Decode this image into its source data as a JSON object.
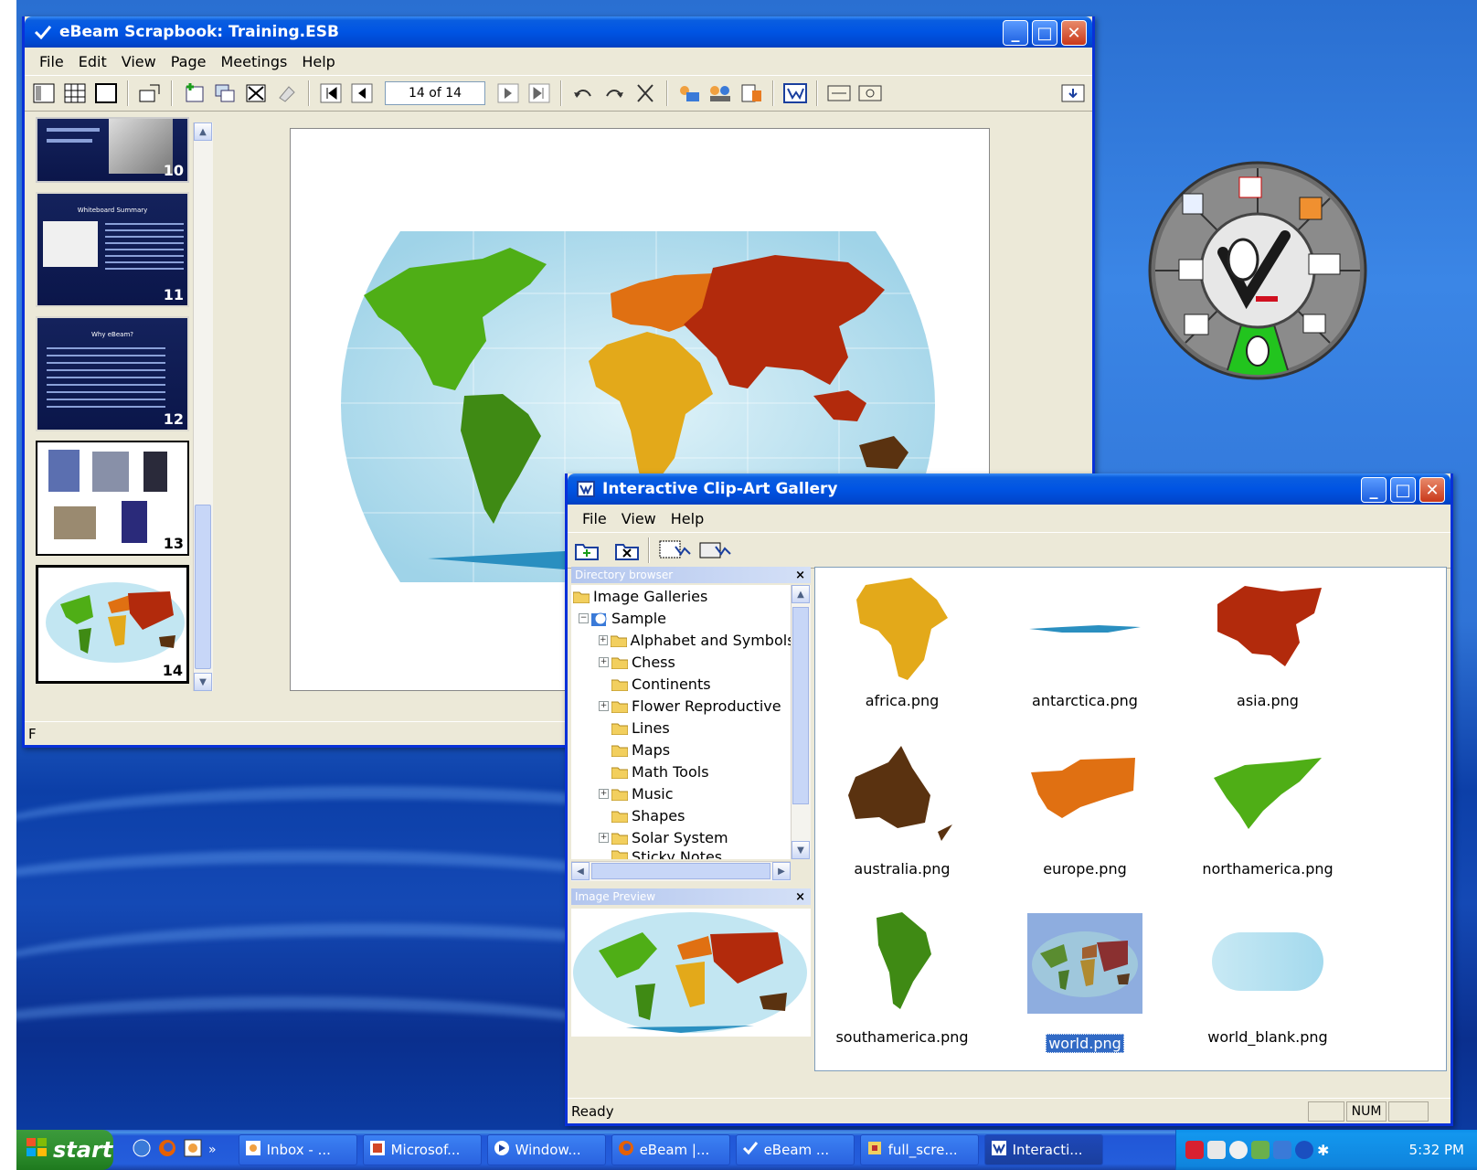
{
  "scrapbook": {
    "title": "eBeam Scrapbook: Training.ESB",
    "menu": [
      "File",
      "Edit",
      "View",
      "Page",
      "Meetings",
      "Help"
    ],
    "page_indicator": "14 of 14",
    "status": "F",
    "thumbnails": [
      {
        "num": "10"
      },
      {
        "num": "11",
        "heading": "Whiteboard Summary"
      },
      {
        "num": "12",
        "heading": "Why eBeam?"
      },
      {
        "num": "13"
      },
      {
        "num": "14"
      }
    ]
  },
  "gallery": {
    "title": "Interactive Clip-Art Gallery",
    "menu": [
      "File",
      "View",
      "Help"
    ],
    "directory_header": "Directory browser",
    "preview_header": "Image Preview",
    "tree": {
      "root": "Image Galleries",
      "sample": "Sample",
      "folders": [
        "Alphabet and Symbols",
        "Chess",
        "Continents",
        "Flower Reproductive",
        "Lines",
        "Maps",
        "Math Tools",
        "Music",
        "Shapes",
        "Solar System",
        "Sticky Notes"
      ]
    },
    "items": [
      {
        "label": "africa.png",
        "color": "#e3a91a"
      },
      {
        "label": "antarctica.png",
        "color": "#2a8fc0"
      },
      {
        "label": "asia.png",
        "color": "#b22a0c"
      },
      {
        "label": "australia.png",
        "color": "#5a3210"
      },
      {
        "label": "europe.png",
        "color": "#e07012"
      },
      {
        "label": "northamerica.png",
        "color": "#4fae16"
      },
      {
        "label": "southamerica.png",
        "color": "#3f8a14"
      },
      {
        "label": "world.png",
        "color": "#316ac5"
      },
      {
        "label": "world_blank.png",
        "color": "#a9dcef"
      }
    ],
    "status": "Ready",
    "num_indicator": "NUM"
  },
  "taskbar": {
    "start": "start",
    "tasks": [
      "Inbox - ...",
      "Microsof...",
      "Window...",
      "eBeam |...",
      "eBeam ...",
      "full_scre...",
      "Interacti..."
    ],
    "clock": "5:32 PM"
  }
}
